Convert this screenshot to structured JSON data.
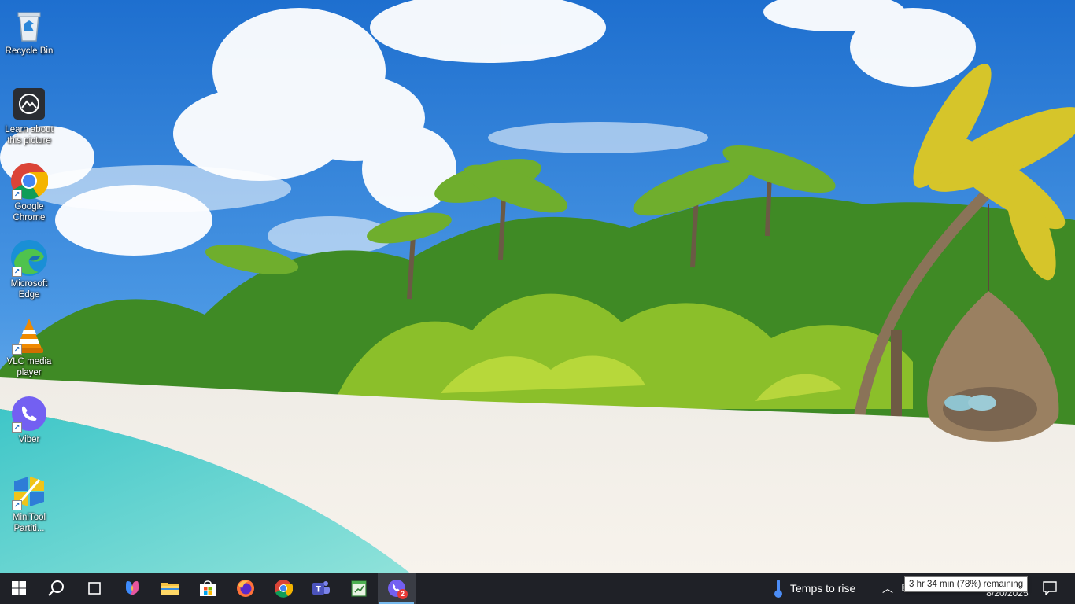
{
  "desktop": {
    "icons": [
      {
        "label": "Recycle Bin",
        "icon": "recycle-bin-icon"
      },
      {
        "label": "Learn about this picture",
        "icon": "camera-icon"
      },
      {
        "label": "Google Chrome",
        "icon": "chrome-icon"
      },
      {
        "label": "Microsoft Edge",
        "icon": "edge-icon"
      },
      {
        "label": "VLC media player",
        "icon": "vlc-icon"
      },
      {
        "label": "Viber",
        "icon": "viber-icon"
      },
      {
        "label": "MiniTool Partiti...",
        "icon": "minitool-icon"
      }
    ]
  },
  "taskbar": {
    "buttons": [
      {
        "name": "start",
        "icon": "windows-logo-icon"
      },
      {
        "name": "search",
        "icon": "search-icon"
      },
      {
        "name": "task-view",
        "icon": "task-view-icon"
      },
      {
        "name": "copilot",
        "icon": "copilot-icon"
      },
      {
        "name": "file-explorer",
        "icon": "folder-icon"
      },
      {
        "name": "microsoft-store",
        "icon": "store-icon"
      },
      {
        "name": "firefox",
        "icon": "firefox-icon"
      },
      {
        "name": "chrome",
        "icon": "chrome-icon"
      },
      {
        "name": "teams",
        "icon": "teams-icon"
      },
      {
        "name": "notepad",
        "icon": "notepad-icon"
      },
      {
        "name": "viber",
        "icon": "viber-icon",
        "badge": "2"
      }
    ],
    "weather_text": "Temps to rise",
    "battery_tooltip": "3 hr 34 min (78%) remaining",
    "clock_date": "8/20/2025"
  },
  "colors": {
    "taskbar_bg": "#1f2127",
    "active_indicator": "#76b9ed",
    "badge": "#e53935"
  }
}
